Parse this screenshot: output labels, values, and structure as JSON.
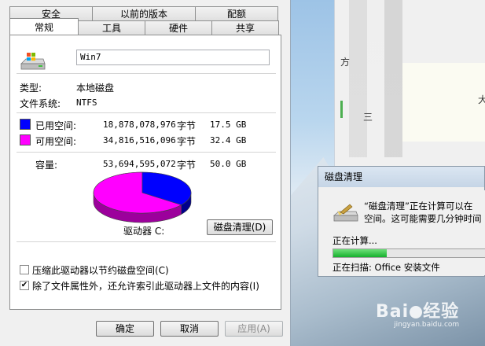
{
  "background": {
    "watermark": "Bai",
    "watermark_suffix": "经验",
    "watermark_sub": "jingyan.baidu.com",
    "fragment_chars": [
      "方",
      "三",
      "大"
    ]
  },
  "dialog": {
    "tabs_back": [
      "安全",
      "以前的版本",
      "配额"
    ],
    "tabs_front": [
      "常规",
      "工具",
      "硬件",
      "共享"
    ],
    "active_tab": "常规",
    "drive_icon": "drive-icon",
    "drive_name": "Win7",
    "type_label": "类型:",
    "type_value": "本地磁盘",
    "fs_label": "文件系统:",
    "fs_value": "NTFS",
    "used": {
      "label": "已用空间:",
      "bytes": "18,878,078,976",
      "unit": "字节",
      "size": "17.5 GB",
      "color": "#0000ff"
    },
    "free": {
      "label": "可用空间:",
      "bytes": "34,816,516,096",
      "unit": "字节",
      "size": "32.4 GB",
      "color": "#ff00ff"
    },
    "capacity": {
      "label": "容量:",
      "bytes": "53,694,595,072",
      "unit": "字节",
      "size": "50.0 GB"
    },
    "used_fraction": 0.352,
    "drive_label": "驱动器 C:",
    "cleanup_button": "磁盘清理(D)",
    "compress_checkbox": {
      "label": "压缩此驱动器以节约磁盘空间(C)",
      "checked": false
    },
    "index_checkbox": {
      "label": "除了文件属性外，还允许索引此驱动器上文件的内容(I)",
      "checked": true
    },
    "ok_button": "确定",
    "cancel_button": "取消",
    "apply_button": "应用(A)"
  },
  "cleanup_dialog": {
    "title": "磁盘清理",
    "message_line1": "“磁盘清理”正在计算可以在",
    "message_line2": "空间。这可能需要几分钟时间",
    "status": "正在计算...",
    "progress": 0.35,
    "scanning": "正在扫描:  Office 安装文件"
  }
}
